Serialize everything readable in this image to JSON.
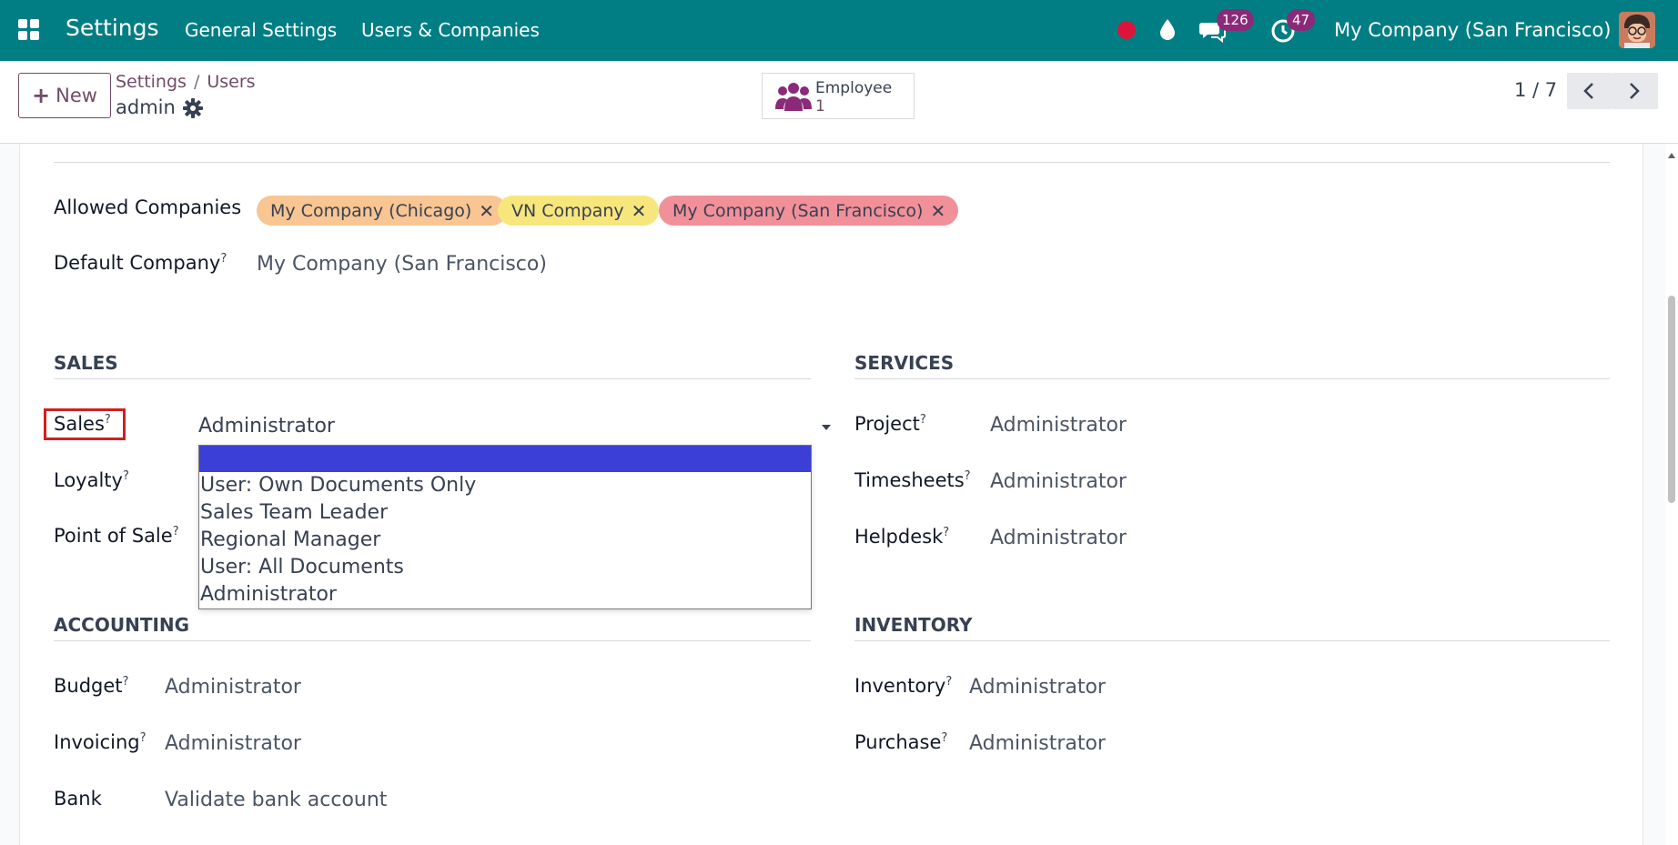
{
  "navbar": {
    "app_title": "Settings",
    "menus": [
      "General Settings",
      "Users & Companies"
    ],
    "chat_badge": "126",
    "activity_badge": "47",
    "company": "My Company (San Francisco)"
  },
  "control": {
    "new_label": "New",
    "breadcrumb_root": "Settings",
    "breadcrumb_sep": "/",
    "breadcrumb_current": "Users",
    "record_name": "admin",
    "stat_label": "Employee",
    "stat_value": "1",
    "pager": "1 / 7"
  },
  "multi_companies": {
    "allowed_label": "Allowed Companies",
    "tags": [
      {
        "label": "My Company (Chicago)",
        "color": "#f8c593"
      },
      {
        "label": "VN Company",
        "color": "#f7e67c"
      },
      {
        "label": "My Company (San Francisco)",
        "color": "#f2909a"
      }
    ],
    "default_label": "Default Company",
    "default_value": "My Company (San Francisco)"
  },
  "sales": {
    "title": "SALES",
    "sales_label": "Sales",
    "sales_value": "Administrator",
    "loyalty_label": "Loyalty",
    "pos_label": "Point of Sale",
    "dropdown_options": [
      "",
      "User: Own Documents Only",
      "Sales Team Leader",
      "Regional Manager",
      "User: All Documents",
      "Administrator"
    ]
  },
  "services": {
    "title": "SERVICES",
    "rows": [
      {
        "label": "Project",
        "value": "Administrator"
      },
      {
        "label": "Timesheets",
        "value": "Administrator"
      },
      {
        "label": "Helpdesk",
        "value": "Administrator"
      }
    ]
  },
  "accounting": {
    "title": "ACCOUNTING",
    "rows": [
      {
        "label": "Budget",
        "value": "Administrator",
        "help": true
      },
      {
        "label": "Invoicing",
        "value": "Administrator",
        "help": true
      },
      {
        "label": "Bank",
        "value": "Validate bank account",
        "help": false
      }
    ]
  },
  "inventory": {
    "title": "INVENTORY",
    "rows": [
      {
        "label": "Inventory",
        "value": "Administrator"
      },
      {
        "label": "Purchase",
        "value": "Administrator"
      }
    ]
  },
  "help_mark": "?",
  "colors": {
    "brand": "#017e84",
    "accent": "#714b67",
    "badge": "#8a2a78",
    "highlight": "#d11f1f",
    "selected": "#3b3fd6"
  }
}
